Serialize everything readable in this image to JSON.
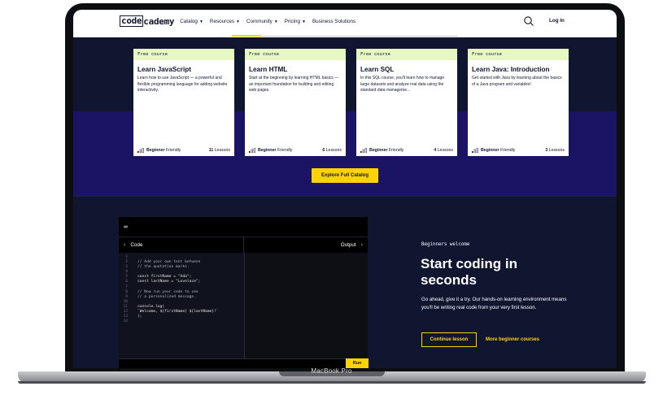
{
  "device": {
    "label": "MacBook Pro"
  },
  "nav": {
    "logo_box": "code",
    "logo_rest": "cademy",
    "links": [
      {
        "label": "Catalog",
        "dropdown": true
      },
      {
        "label": "Resources",
        "dropdown": true
      },
      {
        "label": "Community",
        "dropdown": true
      },
      {
        "label": "Pricing",
        "dropdown": true
      },
      {
        "label": "Business Solutions",
        "dropdown": false
      }
    ],
    "search_icon": "search-icon",
    "login_label": "Log In"
  },
  "courses": [
    {
      "tag": "Free course",
      "title": "Learn JavaScript",
      "description": "Learn how to use JavaScript — a powerful and flexible programming language for adding website interactivity.",
      "level": "Beginner",
      "level_suffix": "Friendly",
      "lessons_count": "11",
      "lessons_label": "Lessons"
    },
    {
      "tag": "Free course",
      "title": "Learn HTML",
      "description": "Start at the beginning by learning HTML basics — an important foundation for building and editing web pages.",
      "level": "Beginner",
      "level_suffix": "Friendly",
      "lessons_count": "6",
      "lessons_label": "Lessons"
    },
    {
      "tag": "Free course",
      "title": "Learn SQL",
      "description": "In this SQL course, you'll learn how to manage large datasets and analyze real data using the standard data manageme...",
      "level": "Beginner",
      "level_suffix": "Friendly",
      "lessons_count": "4",
      "lessons_label": "Lessons"
    },
    {
      "tag": "Free course",
      "title": "Learn Java: Introduction",
      "description": "Get started with Java by learning about the basics of a Java program and variables!",
      "level": "Beginner",
      "level_suffix": "Friendly",
      "lessons_count": "3",
      "lessons_label": "Lessons"
    }
  ],
  "explore_button": "Explore Full Catalog",
  "editor": {
    "code_tab": "Code",
    "output_tab": "Output",
    "run_label": "Run",
    "lines": [
      {
        "n": "1",
        "text": "",
        "kind": "plain"
      },
      {
        "n": "2",
        "text": "// Add your own text between",
        "kind": "comment"
      },
      {
        "n": "3",
        "text": "// the quotation marks.",
        "kind": "comment"
      },
      {
        "n": "4",
        "text": "",
        "kind": "plain"
      },
      {
        "n": "5",
        "text": "const firstName = \"Ada\";",
        "kind": "plain"
      },
      {
        "n": "6",
        "text": "const lastName = \"Lovelace\";",
        "kind": "plain"
      },
      {
        "n": "7",
        "text": "",
        "kind": "plain"
      },
      {
        "n": "8",
        "text": "// Now run your code to see",
        "kind": "comment"
      },
      {
        "n": "9",
        "text": "// a personalized message.",
        "kind": "comment"
      },
      {
        "n": "10",
        "text": "",
        "kind": "plain"
      },
      {
        "n": "11",
        "text": "console.log(",
        "kind": "plain"
      },
      {
        "n": "12",
        "text": "`Welcome, ${firstName} ${lastName}!`",
        "kind": "plain"
      },
      {
        "n": "13",
        "text": ");",
        "kind": "plain"
      },
      {
        "n": "14",
        "text": "",
        "kind": "plain"
      }
    ]
  },
  "hero": {
    "eyebrow": "Beginners welcome",
    "title": "Start coding in seconds",
    "description": "Go ahead, give it a try. Our hands-on learning environment means you'll be writing real code from your very first lesson.",
    "continue_label": "Continue lesson",
    "more_label": "More beginner courses"
  },
  "colors": {
    "navy": "#10162f",
    "purple": "#1b1464",
    "yellow": "#ffd300",
    "tag_green": "#e8f8c3"
  }
}
